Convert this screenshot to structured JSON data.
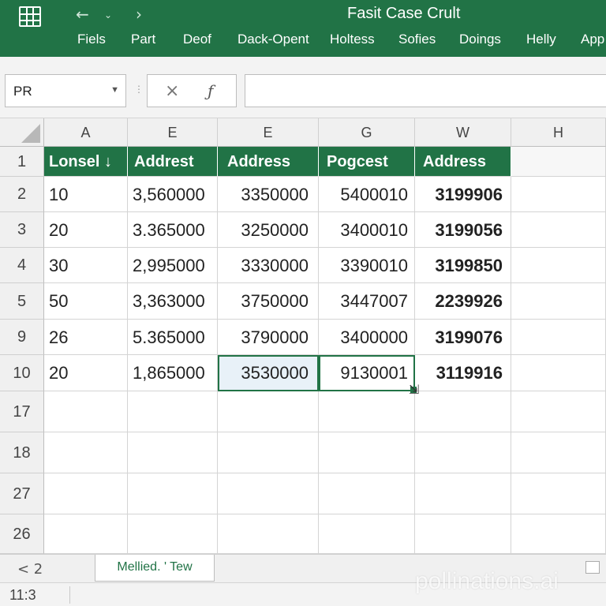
{
  "ribbon": {
    "title": "Fasit Case Crult",
    "tabs": [
      "Fiels",
      "Part",
      "Deof",
      "Dack-Opent",
      "Holtess",
      "Sofies",
      "Doings",
      "Helly",
      "App"
    ],
    "icons": {
      "app": "spreadsheet-grid-icon",
      "back": "undo-arrow-icon",
      "dropdown": "chevron-down-icon",
      "forward": "redo-arrow-icon"
    },
    "back_glyph": "←",
    "dropdown_glyph": "⌄",
    "forward_glyph": "›",
    "accent_color": "#217346"
  },
  "formula_bar": {
    "name_box_value": "PR",
    "name_box_arrow": "▼",
    "separator": "⋮",
    "cancel_glyph": "×",
    "function_glyph": "ƒ",
    "formula_value": ""
  },
  "grid": {
    "column_headers": [
      "A",
      "E",
      "E",
      "G",
      "W",
      "H"
    ],
    "row_headers": [
      "1",
      "2",
      "3",
      "4",
      "5",
      "9",
      "10",
      "17",
      "18",
      "27",
      "26"
    ],
    "header_row": [
      "Lonsel ↓",
      "Addrest",
      "Address",
      "Pogcest",
      "Address"
    ],
    "rows": [
      [
        "10",
        "3,560000",
        "3350000",
        "5400010",
        "3199906"
      ],
      [
        "20",
        "3.365000",
        "3250000",
        "3400010",
        "3199056"
      ],
      [
        "30",
        "2,995000",
        "3330000",
        "3390010",
        "3199850"
      ],
      [
        "50",
        "3,363000",
        "3750000",
        "3447007",
        "2239926"
      ],
      [
        "26",
        "5.365000",
        "3790000",
        "3400000",
        "3199076"
      ],
      [
        "20",
        "1,865000",
        "3530000",
        "9130001",
        "3119916"
      ]
    ],
    "cursor_glyph": "⇲"
  },
  "sheets": {
    "nav_label": "< 2",
    "active_tab": "Mellied. ' Tew"
  },
  "status": {
    "text": "11:3"
  },
  "watermark": "pollinations.ai"
}
